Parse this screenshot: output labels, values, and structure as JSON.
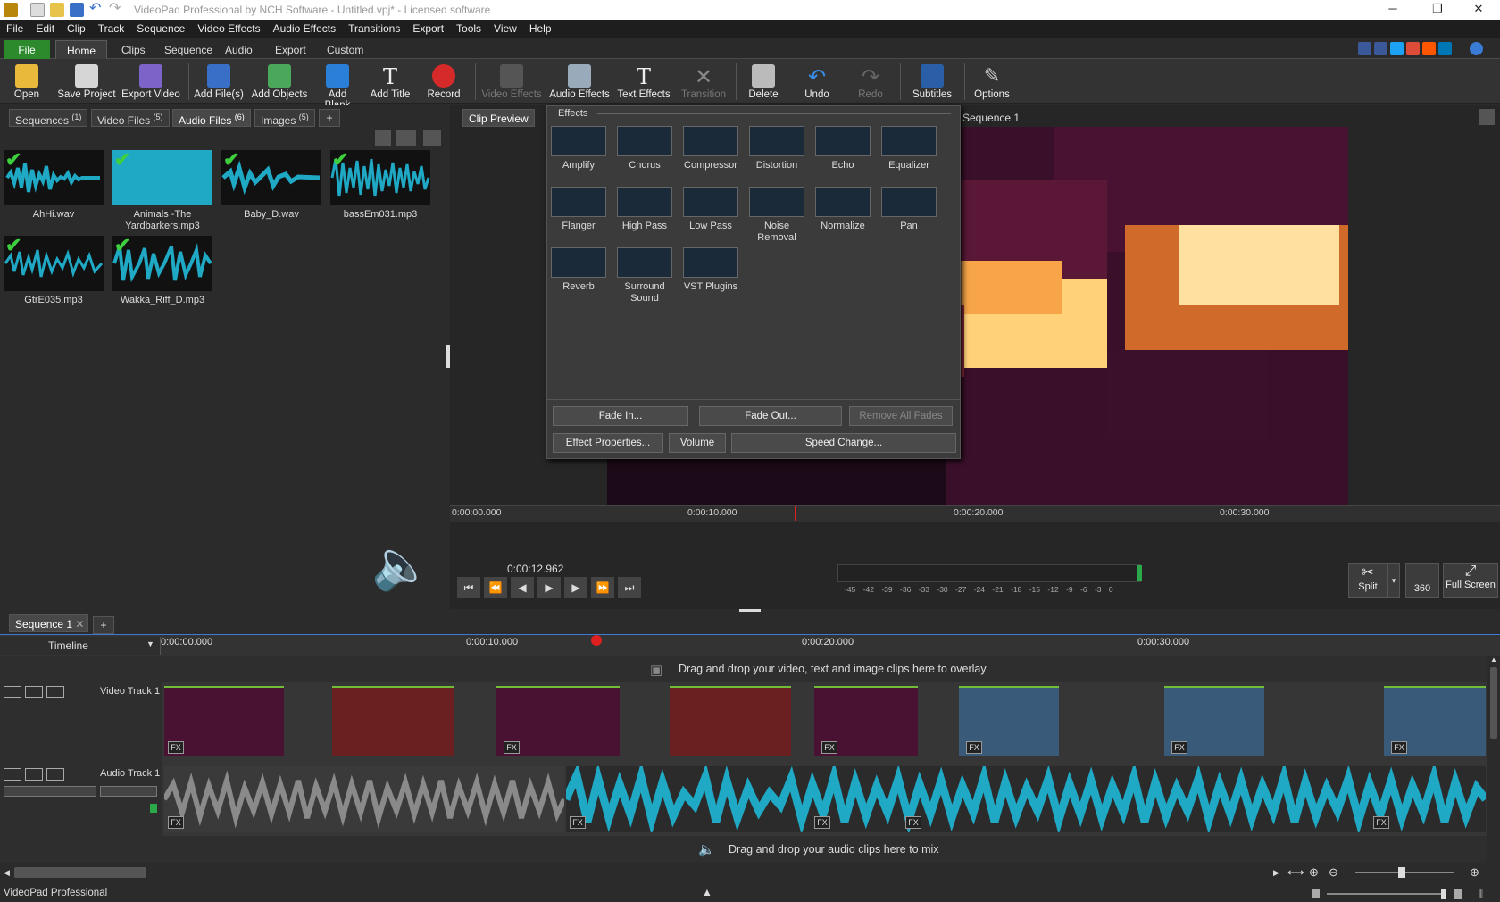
{
  "window": {
    "title": "VideoPad Professional by NCH Software - Untitled.vpj* - Licensed software"
  },
  "menu": [
    "File",
    "Edit",
    "Clip",
    "Track",
    "Sequence",
    "Video Effects",
    "Audio Effects",
    "Transitions",
    "Export",
    "Tools",
    "View",
    "Help"
  ],
  "ribbon_tabs": [
    "File",
    "Home",
    "Clips",
    "Sequence",
    "Audio",
    "Export",
    "Custom"
  ],
  "toolbar": [
    "Open",
    "Save Project",
    "Export Video",
    "Add File(s)",
    "Add Objects",
    "Add Blank",
    "Add Title",
    "Record",
    "Video Effects",
    "Audio Effects",
    "Text Effects",
    "Transition",
    "Delete",
    "Undo",
    "Redo",
    "Subtitles",
    "Options"
  ],
  "bin": {
    "tabs": [
      {
        "label": "Sequences",
        "count": "(1)"
      },
      {
        "label": "Video Files",
        "count": "(5)"
      },
      {
        "label": "Audio Files",
        "count": "(6)"
      },
      {
        "label": "Images",
        "count": "(5)"
      }
    ],
    "add_tab": "+",
    "files": [
      "AhHi.wav",
      "Animals -The Yardbarkers.mp3",
      "Baby_D.wav",
      "bassEm031.mp3",
      "GtrE035.mp3",
      "Wakka_Riff_D.mp3"
    ]
  },
  "preview": {
    "tabs": [
      "Clip Preview",
      "Sequence 1"
    ],
    "ruler": [
      "0:00:00.000",
      "0:00:10.000",
      "0:00:20.000",
      "0:00:30.000"
    ],
    "timecode": "0:00:12.962",
    "meter": [
      "-45",
      "-42",
      "-39",
      "-36",
      "-33",
      "-30",
      "-27",
      "-24",
      "-21",
      "-18",
      "-15",
      "-12",
      "-9",
      "-6",
      "-3",
      "0"
    ],
    "split": "Split",
    "badge_360": "360",
    "fullscreen": "Full Screen"
  },
  "effects_popup": {
    "header": "Effects",
    "items": [
      "Amplify",
      "Chorus",
      "Compressor",
      "Distortion",
      "Echo",
      "Equalizer",
      "Flanger",
      "High Pass",
      "Low Pass",
      "Noise Removal",
      "Normalize",
      "Pan",
      "Reverb",
      "Surround Sound",
      "VST Plugins"
    ],
    "fade_in": "Fade In...",
    "fade_out": "Fade Out...",
    "remove_fades": "Remove All Fades",
    "effect_properties": "Effect Properties...",
    "volume": "Volume",
    "speed_change": "Speed Change..."
  },
  "timeline": {
    "seq_tab": "Sequence 1",
    "add_tab": "+",
    "mode": "Timeline",
    "ruler": [
      "0:00:00.000",
      "0:00:10.000",
      "0:00:20.000",
      "0:00:30.000"
    ],
    "overlay_hint": "Drag and drop your video, text and image clips here to overlay",
    "video_track": "Video Track 1",
    "audio_track": "Audio Track 1",
    "audio_hint": "Drag and drop your audio clips here to mix",
    "fx_label": "FX"
  },
  "status": {
    "app": "VideoPad Professional"
  },
  "colors": {
    "accent_green": "#2c8a2c",
    "waveform": "#1fa9c4",
    "playhead": "#e02020"
  }
}
